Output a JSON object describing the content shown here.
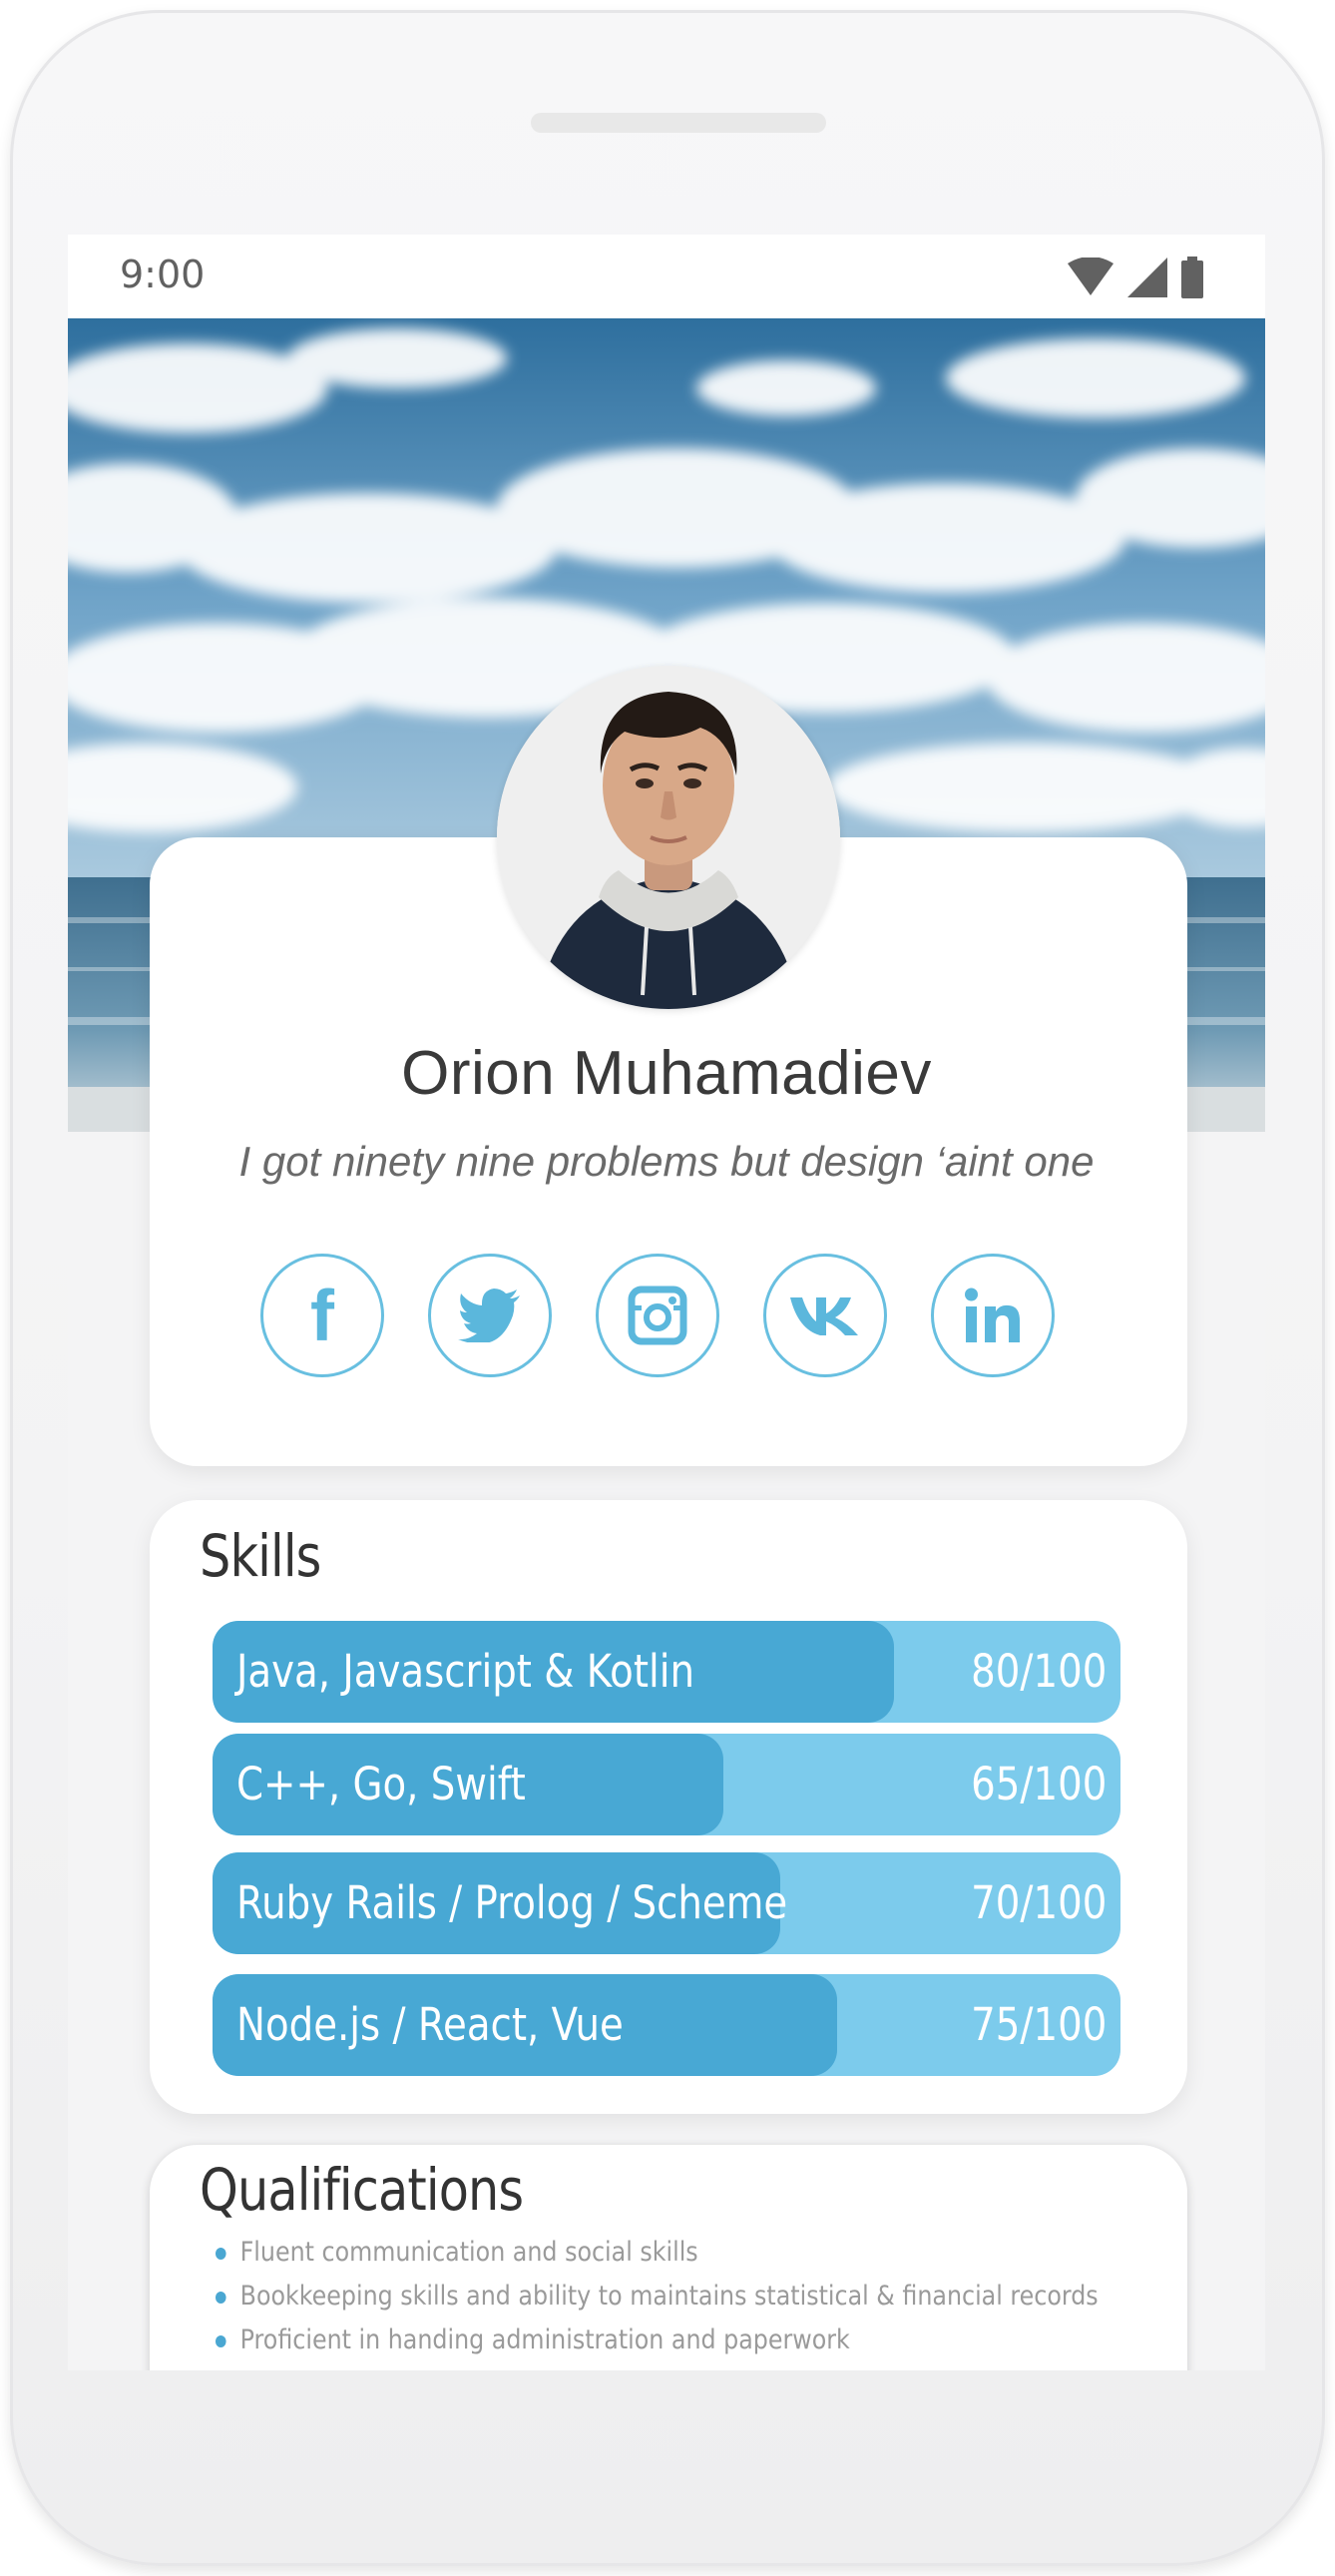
{
  "statusbar": {
    "time": "9:00"
  },
  "profile": {
    "name": "Orion Muhamadiev",
    "bio": "I got ninety nine problems but design ‘aint one"
  },
  "socials": [
    {
      "icon": "facebook-icon"
    },
    {
      "icon": "twitter-icon"
    },
    {
      "icon": "instagram-icon"
    },
    {
      "icon": "vk-icon"
    },
    {
      "icon": "linkedin-icon"
    }
  ],
  "skills": {
    "title": "Skills",
    "items": [
      {
        "label": "Java, Javascript & Kotlin",
        "value": "80/100",
        "score": 80
      },
      {
        "label": "C++, Go, Swift",
        "value": "65/100",
        "score": 65
      },
      {
        "label": "Ruby Rails / Prolog / Scheme",
        "value": "70/100",
        "score": 70
      },
      {
        "label": "Node.js / React, Vue",
        "value": "75/100",
        "score": 75
      }
    ]
  },
  "qualifications": {
    "title": "Qualifications",
    "items": [
      "Fluent communication and social skills",
      "Bookkeeping skills and ability to maintains statistical & financial records",
      "Proficient in handing administration and paperwork"
    ]
  },
  "colors": {
    "accent": "#48a8d4",
    "accent_light": "#7ccbec",
    "icon_outline": "#68bfe0"
  }
}
